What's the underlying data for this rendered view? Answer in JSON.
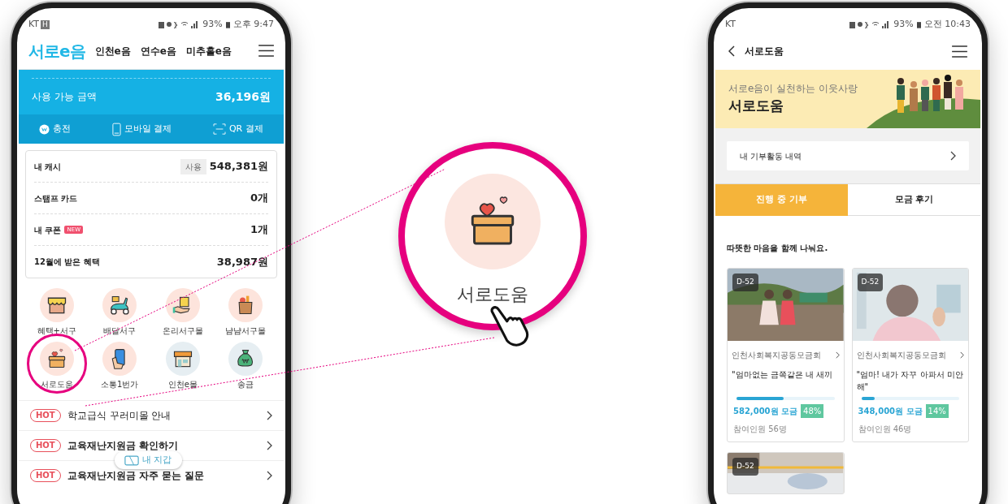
{
  "left_phone": {
    "status_bar": {
      "carrier": "KT",
      "network": "H",
      "battery": "93%",
      "time": "오후 9:47"
    },
    "header": {
      "logo": "서로e음",
      "nav": [
        {
          "label": "인천e음"
        },
        {
          "label": "연수e음"
        },
        {
          "label": "미추홀e음"
        }
      ]
    },
    "balance": {
      "label": "사용 가능 금액",
      "amount": "36,196원"
    },
    "actions": [
      {
        "label": "충전",
        "kind": "coin"
      },
      {
        "label": "모바일 결제",
        "kind": "phone"
      },
      {
        "label": "QR 결제",
        "kind": "qr"
      }
    ],
    "summary": [
      {
        "label": "내 캐시",
        "chip": "사용",
        "value": "548,381원"
      },
      {
        "label": "스탬프 카드",
        "value": "0개"
      },
      {
        "label": "내 쿠폰",
        "badge": "NEW",
        "value": "1개"
      },
      {
        "label": "12월에 받은 혜택",
        "value": "38,987원"
      }
    ],
    "services": [
      {
        "label": "혜택+서구",
        "kind": "shop",
        "highlighted": false
      },
      {
        "label": "배달서구",
        "kind": "scooter",
        "highlighted": false
      },
      {
        "label": "온리서구몰",
        "kind": "handbag",
        "highlighted": false
      },
      {
        "label": "냠냠서구몰",
        "kind": "grocery",
        "highlighted": false
      },
      {
        "label": "서로도움",
        "kind": "donation",
        "highlighted": true
      },
      {
        "label": "소통1번가",
        "kind": "phone",
        "highlighted": false
      },
      {
        "label": "인천e몰",
        "kind": "store",
        "highlighted": false
      },
      {
        "label": "송금",
        "kind": "money",
        "highlighted": false
      }
    ],
    "notices": [
      {
        "badge": "HOT",
        "title": "학교급식 꾸러미몰 안내"
      },
      {
        "badge": "HOT",
        "title": "교육재난지원금 확인하기"
      },
      {
        "badge": "HOT",
        "title": "교육재난지원금 자주 묻는 질문"
      }
    ],
    "wallet_button": {
      "label": "내 지갑"
    }
  },
  "callout": {
    "label": "서로도움"
  },
  "right_phone": {
    "status_bar": {
      "carrier": "KT",
      "battery": "93%",
      "time": "오전 10:43"
    },
    "header": {
      "title": "서로도움"
    },
    "banner": {
      "subtitle": "서로e음이 실천하는 이웃사랑",
      "title": "서로도움"
    },
    "history_link": {
      "label": "내 기부활동 내역"
    },
    "tabs": [
      {
        "label": "진행 중 기부",
        "selected": true
      },
      {
        "label": "모금 후기",
        "selected": false
      }
    ],
    "section_title": "따뜻한 마음을 함께 나눠요.",
    "campaigns": [
      {
        "badge": "D-52",
        "kind": "outdoor",
        "org": "인천사회복지공동모금회",
        "title": "\"엄마없는 금쪽같은 내 새끼",
        "level": 0.48,
        "raised": "582,000원 모금",
        "percent": "48%",
        "participants": "참여인원 56명"
      },
      {
        "badge": "D-52",
        "kind": "indoor",
        "org": "인천사회복지공동모금회",
        "title": "\"엄마! 내가 자꾸 아파서 미안해\"",
        "level": 0.14,
        "raised": "348,000원 모금",
        "percent": "14%",
        "participants": "참여인원 46명"
      },
      {
        "badge": "D-52",
        "kind": "bed"
      }
    ]
  }
}
